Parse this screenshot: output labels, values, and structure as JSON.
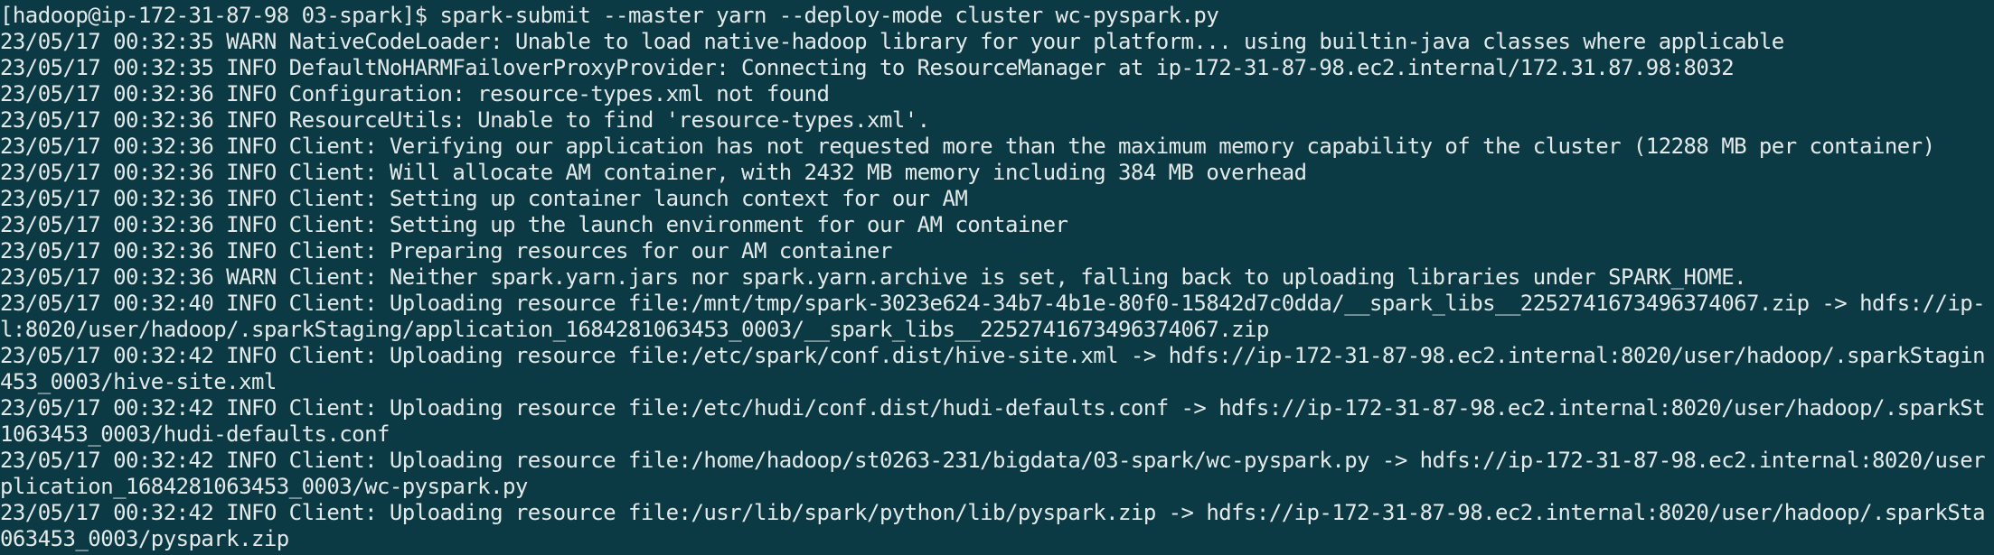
{
  "terminal": {
    "lines": [
      "[hadoop@ip-172-31-87-98 03-spark]$ spark-submit --master yarn --deploy-mode cluster wc-pyspark.py",
      "23/05/17 00:32:35 WARN NativeCodeLoader: Unable to load native-hadoop library for your platform... using builtin-java classes where applicable",
      "23/05/17 00:32:35 INFO DefaultNoHARMFailoverProxyProvider: Connecting to ResourceManager at ip-172-31-87-98.ec2.internal/172.31.87.98:8032",
      "23/05/17 00:32:36 INFO Configuration: resource-types.xml not found",
      "23/05/17 00:32:36 INFO ResourceUtils: Unable to find 'resource-types.xml'.",
      "23/05/17 00:32:36 INFO Client: Verifying our application has not requested more than the maximum memory capability of the cluster (12288 MB per container)",
      "23/05/17 00:32:36 INFO Client: Will allocate AM container, with 2432 MB memory including 384 MB overhead",
      "23/05/17 00:32:36 INFO Client: Setting up container launch context for our AM",
      "23/05/17 00:32:36 INFO Client: Setting up the launch environment for our AM container",
      "23/05/17 00:32:36 INFO Client: Preparing resources for our AM container",
      "23/05/17 00:32:36 WARN Client: Neither spark.yarn.jars nor spark.yarn.archive is set, falling back to uploading libraries under SPARK_HOME.",
      "23/05/17 00:32:40 INFO Client: Uploading resource file:/mnt/tmp/spark-3023e624-34b7-4b1e-80f0-15842d7c0dda/__spark_libs__2252741673496374067.zip -> hdfs://ip-",
      "l:8020/user/hadoop/.sparkStaging/application_1684281063453_0003/__spark_libs__2252741673496374067.zip",
      "23/05/17 00:32:42 INFO Client: Uploading resource file:/etc/spark/conf.dist/hive-site.xml -> hdfs://ip-172-31-87-98.ec2.internal:8020/user/hadoop/.sparkStagin",
      "453_0003/hive-site.xml",
      "23/05/17 00:32:42 INFO Client: Uploading resource file:/etc/hudi/conf.dist/hudi-defaults.conf -> hdfs://ip-172-31-87-98.ec2.internal:8020/user/hadoop/.sparkSt",
      "1063453_0003/hudi-defaults.conf",
      "23/05/17 00:32:42 INFO Client: Uploading resource file:/home/hadoop/st0263-231/bigdata/03-spark/wc-pyspark.py -> hdfs://ip-172-31-87-98.ec2.internal:8020/user",
      "plication_1684281063453_0003/wc-pyspark.py",
      "23/05/17 00:32:42 INFO Client: Uploading resource file:/usr/lib/spark/python/lib/pyspark.zip -> hdfs://ip-172-31-87-98.ec2.internal:8020/user/hadoop/.sparkSta",
      "063453_0003/pyspark.zip"
    ]
  }
}
